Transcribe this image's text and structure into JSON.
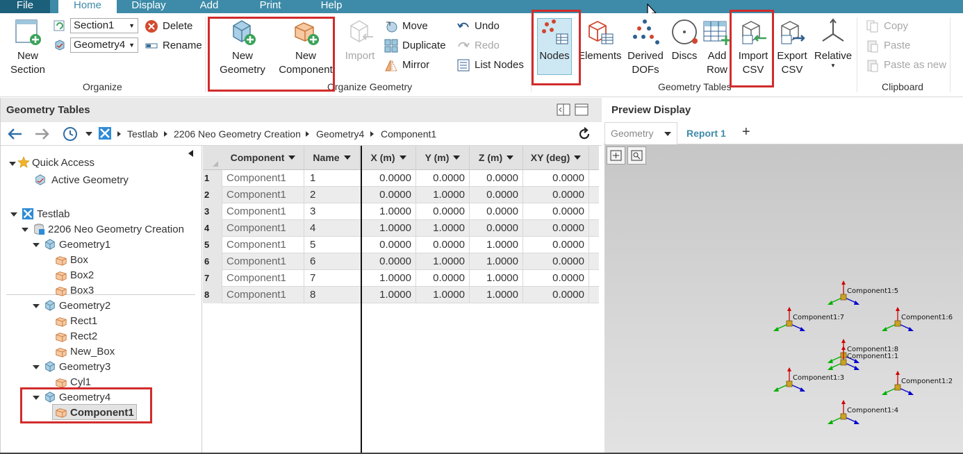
{
  "menu": {
    "file": "File",
    "home": "Home",
    "display": "Display",
    "add": "Add",
    "print": "Print",
    "help": "Help"
  },
  "ribbon": {
    "organize": {
      "new_section_line1": "New",
      "new_section_line2": "Section",
      "section_combo": "Section1",
      "geometry_combo": "Geometry4",
      "delete": "Delete",
      "rename": "Rename",
      "label": "Organize"
    },
    "organize_geometry": {
      "new_geometry_line1": "New",
      "new_geometry_line2": "Geometry",
      "new_component_line1": "New",
      "new_component_line2": "Component",
      "import": "Import",
      "move": "Move",
      "duplicate": "Duplicate",
      "mirror": "Mirror",
      "undo": "Undo",
      "redo": "Redo",
      "list_nodes": "List Nodes",
      "label": "Organize Geometry"
    },
    "geometry_tables": {
      "nodes": "Nodes",
      "elements": "Elements",
      "derived_line1": "Derived",
      "derived_line2": "DOFs",
      "discs": "Discs",
      "add_row_line1": "Add",
      "add_row_line2": "Row",
      "import_csv_line1": "Import",
      "import_csv_line2": "CSV",
      "export_csv_line1": "Export",
      "export_csv_line2": "CSV",
      "relative": "Relative",
      "label": "Geometry Tables"
    },
    "clipboard": {
      "copy": "Copy",
      "paste": "Paste",
      "paste_as_new": "Paste as new",
      "label": "Clipboard"
    }
  },
  "left_panel": {
    "title": "Geometry Tables",
    "breadcrumb": [
      "Testlab",
      "2206 Neo Geometry Creation",
      "Geometry4",
      "Component1"
    ]
  },
  "tree": {
    "quick_access": "Quick Access",
    "active_geometry": "Active Geometry",
    "testlab": "Testlab",
    "project": "2206 Neo Geometry Creation",
    "geometry1": "Geometry1",
    "box": "Box",
    "box2": "Box2",
    "box3": "Box3",
    "geometry2": "Geometry2",
    "rect1": "Rect1",
    "rect2": "Rect2",
    "new_box": "New_Box",
    "geometry3": "Geometry3",
    "cyl1": "Cyl1",
    "geometry4": "Geometry4",
    "component1": "Component1"
  },
  "table": {
    "headers": [
      "Component",
      "Name",
      "X (m)",
      "Y (m)",
      "Z (m)",
      "XY (deg)"
    ],
    "rows": [
      {
        "n": "1",
        "component": "Component1",
        "name": "1",
        "x": "0.0000",
        "y": "0.0000",
        "z": "0.0000",
        "xy": "0.0000"
      },
      {
        "n": "2",
        "component": "Component1",
        "name": "2",
        "x": "0.0000",
        "y": "1.0000",
        "z": "0.0000",
        "xy": "0.0000"
      },
      {
        "n": "3",
        "component": "Component1",
        "name": "3",
        "x": "1.0000",
        "y": "0.0000",
        "z": "0.0000",
        "xy": "0.0000"
      },
      {
        "n": "4",
        "component": "Component1",
        "name": "4",
        "x": "1.0000",
        "y": "1.0000",
        "z": "0.0000",
        "xy": "0.0000"
      },
      {
        "n": "5",
        "component": "Component1",
        "name": "5",
        "x": "0.0000",
        "y": "0.0000",
        "z": "1.0000",
        "xy": "0.0000"
      },
      {
        "n": "6",
        "component": "Component1",
        "name": "6",
        "x": "0.0000",
        "y": "1.0000",
        "z": "1.0000",
        "xy": "0.0000"
      },
      {
        "n": "7",
        "component": "Component1",
        "name": "7",
        "x": "1.0000",
        "y": "0.0000",
        "z": "1.0000",
        "xy": "0.0000"
      },
      {
        "n": "8",
        "component": "Component1",
        "name": "8",
        "x": "1.0000",
        "y": "1.0000",
        "z": "1.0000",
        "xy": "0.0000"
      }
    ]
  },
  "right_panel": {
    "title": "Preview Display",
    "tab_geometry": "Geometry",
    "tab_report": "Report 1",
    "tab_add": "+",
    "nodes": [
      "Component1:5",
      "Component1:7",
      "Component1:6",
      "Component1:8",
      "Component1:1",
      "Component1:3",
      "Component1:2",
      "Component1:4"
    ]
  },
  "colors": {
    "menu_bar": "#3d8ba8",
    "highlight_box": "#d22b2b",
    "accent_text": "#3d8ba8"
  }
}
